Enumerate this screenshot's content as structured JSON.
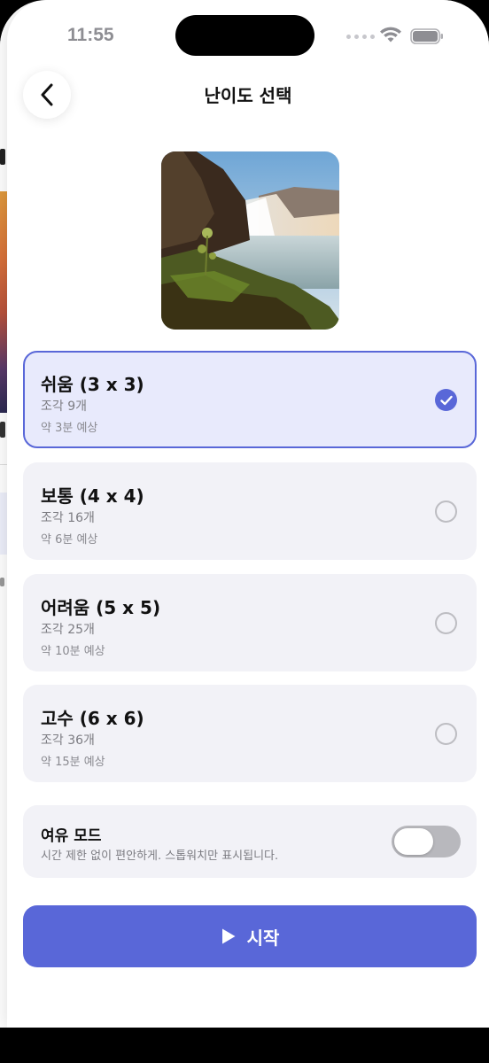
{
  "status_bar": {
    "time": "11:55"
  },
  "header": {
    "title": "난이도 선택"
  },
  "colors": {
    "accent": "#5967d8",
    "selected_bg": "#e8eafc",
    "card_bg": "#f2f2f7"
  },
  "options": [
    {
      "title": "쉬움 (3 x 3)",
      "pieces": "조각 9개",
      "time": "약 3분 예상",
      "selected": true
    },
    {
      "title": "보통 (4 x 4)",
      "pieces": "조각 16개",
      "time": "약 6분 예상",
      "selected": false
    },
    {
      "title": "어려움 (5 x 5)",
      "pieces": "조각 25개",
      "time": "약 10분 예상",
      "selected": false
    },
    {
      "title": "고수 (6 x 6)",
      "pieces": "조각 36개",
      "time": "약 15분 예상",
      "selected": false
    }
  ],
  "relax_mode": {
    "title": "여유 모드",
    "description": "시간 제한 없이 편안하게. 스톱워치만 표시됩니다.",
    "enabled": false
  },
  "start_button": {
    "label": "시작",
    "icon": "play-icon"
  }
}
